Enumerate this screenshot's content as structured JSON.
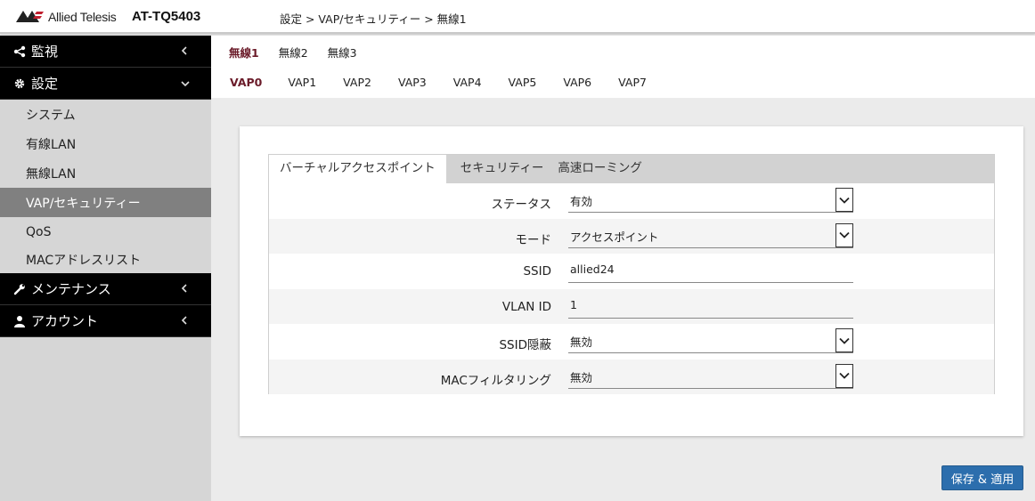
{
  "header": {
    "brand": "Allied Telesis",
    "model": "AT-TQ5403",
    "breadcrumb": "設定 > VAP/セキュリティー > 無線1"
  },
  "sidebar": {
    "groups": [
      {
        "label": "監視",
        "icon": "share-icon",
        "chevron": "‹"
      },
      {
        "label": "設定",
        "icon": "gear-icon",
        "chevron": "⌄"
      }
    ],
    "items": [
      {
        "label": "システム"
      },
      {
        "label": "有線LAN"
      },
      {
        "label": "無線LAN"
      },
      {
        "label": "VAP/セキュリティー"
      },
      {
        "label": "QoS"
      },
      {
        "label": "MACアドレスリスト"
      }
    ],
    "groups_bottom": [
      {
        "label": "メンテナンス",
        "icon": "wrench-icon",
        "chevron": "‹"
      },
      {
        "label": "アカウント",
        "icon": "user-icon",
        "chevron": "‹"
      }
    ]
  },
  "radio_tabs": [
    "無線1",
    "無線2",
    "無線3"
  ],
  "vap_tabs": [
    "VAP0",
    "VAP1",
    "VAP2",
    "VAP3",
    "VAP4",
    "VAP5",
    "VAP6",
    "VAP7"
  ],
  "subtabs": [
    "バーチャルアクセスポイント",
    "セキュリティー",
    "高速ローミング"
  ],
  "form": {
    "status": {
      "label": "ステータス",
      "value": "有効"
    },
    "mode": {
      "label": "モード",
      "value": "アクセスポイント"
    },
    "ssid": {
      "label": "SSID",
      "value": "allied24"
    },
    "vlan_id": {
      "label": "VLAN ID",
      "value": "1"
    },
    "ssid_hidden": {
      "label": "SSID隠蔽",
      "value": "無効"
    },
    "mac_filter": {
      "label": "MACフィルタリング",
      "value": "無効"
    }
  },
  "save_button": "保存 & 適用",
  "colors": {
    "accent": "#6b1c2a",
    "button": "#2c6ead",
    "sidebar_active": "#808080"
  }
}
